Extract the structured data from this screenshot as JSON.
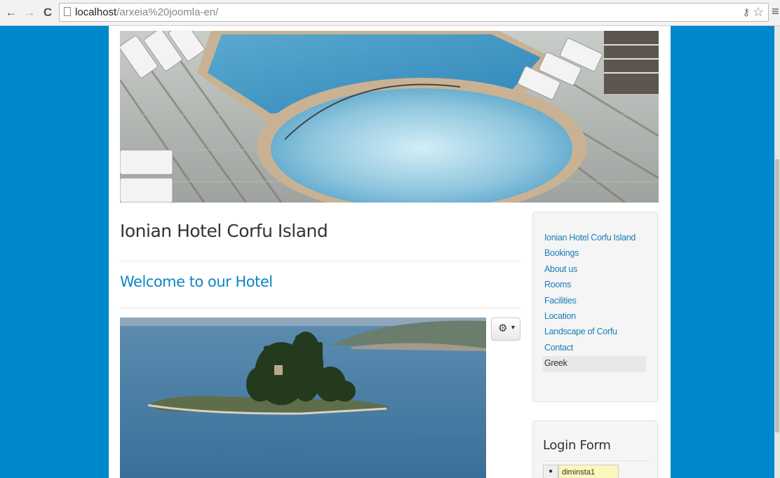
{
  "browser": {
    "back_icon": "arrow-left",
    "forward_icon": "arrow-right",
    "reload_icon": "reload",
    "url_host": "localhost",
    "url_path": "/arxeia%20joomla-en/"
  },
  "site": {
    "title": "Ionian Hotel Corfu Island"
  },
  "article": {
    "title": "Welcome to our Hotel"
  },
  "menu": {
    "items": [
      {
        "label": "Ionian Hotel Corfu Island"
      },
      {
        "label": "Bookings"
      },
      {
        "label": "About us"
      },
      {
        "label": "Rooms"
      },
      {
        "label": "Facilities"
      },
      {
        "label": "Location"
      },
      {
        "label": "Landscape of Corfu"
      },
      {
        "label": "Contact"
      },
      {
        "label": "Greek"
      }
    ],
    "active": "Greek"
  },
  "login": {
    "title": "Login Form",
    "username_value": "diminsta1"
  },
  "colors": {
    "background": "#0088cc",
    "link": "#1a7db8",
    "heading_link": "#0c87c5"
  }
}
